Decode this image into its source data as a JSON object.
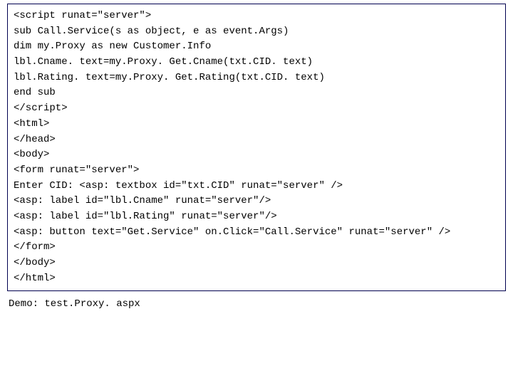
{
  "lines": [
    "<script runat=\"server\">",
    "sub Call.Service(s as object, e as event.Args)",
    "dim my.Proxy as new Customer.Info",
    "lbl.Cname. text=my.Proxy. Get.Cname(txt.CID. text)",
    "lbl.Rating. text=my.Proxy. Get.Rating(txt.CID. text)",
    "end sub",
    "</script>",
    "<html>",
    "</head>",
    "<body>",
    "<form runat=\"server\">",
    "Enter CID: <asp: textbox id=\"txt.CID\" runat=\"server\" />",
    "<asp: label id=\"lbl.Cname\" runat=\"server\"/>",
    "<asp: label id=\"lbl.Rating\" runat=\"server\"/>",
    "<asp: button text=\"Get.Service\" on.Click=\"Call.Service\" runat=\"server\" />",
    "</form>",
    "</body>",
    "</html>"
  ],
  "demo": "Demo: test.Proxy. aspx"
}
